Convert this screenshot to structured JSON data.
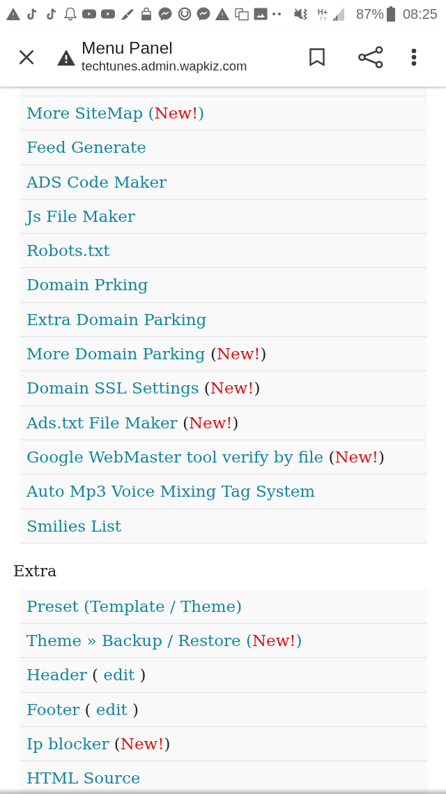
{
  "status_bar": {
    "network_type": "H+",
    "battery": "87%",
    "time": "08:25"
  },
  "toolbar": {
    "title": "Menu Panel",
    "url": "techtunes.admin.wapkiz.com"
  },
  "sections": [
    {
      "items": [
        {
          "parts": [
            {
              "kind": "link",
              "text": "More SiteMap ("
            },
            {
              "kind": "new",
              "text": "New!"
            },
            {
              "kind": "link",
              "text": ")"
            }
          ]
        },
        {
          "parts": [
            {
              "kind": "link",
              "text": "Feed Generate"
            }
          ]
        },
        {
          "parts": [
            {
              "kind": "link",
              "text": "ADS Code Maker"
            }
          ]
        },
        {
          "parts": [
            {
              "kind": "link",
              "text": "Js File Maker"
            }
          ]
        },
        {
          "parts": [
            {
              "kind": "link",
              "text": "Robots.txt"
            }
          ]
        },
        {
          "parts": [
            {
              "kind": "link",
              "text": "Domain Prking"
            }
          ]
        },
        {
          "parts": [
            {
              "kind": "link",
              "text": "Extra Domain Parking"
            }
          ]
        },
        {
          "parts": [
            {
              "kind": "link",
              "text": "More Domain Parking"
            },
            {
              "kind": "plain",
              "text": " ("
            },
            {
              "kind": "new",
              "text": "New!"
            },
            {
              "kind": "plain",
              "text": ")"
            }
          ]
        },
        {
          "parts": [
            {
              "kind": "link",
              "text": "Domain SSL Settings"
            },
            {
              "kind": "plain",
              "text": " ("
            },
            {
              "kind": "new",
              "text": "New!"
            },
            {
              "kind": "plain",
              "text": ")"
            }
          ]
        },
        {
          "parts": [
            {
              "kind": "link",
              "text": "Ads.txt File Maker"
            },
            {
              "kind": "plain",
              "text": " ("
            },
            {
              "kind": "new",
              "text": "New!"
            },
            {
              "kind": "plain",
              "text": ")"
            }
          ]
        },
        {
          "parts": [
            {
              "kind": "link",
              "text": "Google WebMaster tool verify by file"
            },
            {
              "kind": "plain",
              "text": " ("
            },
            {
              "kind": "new",
              "text": "New!"
            },
            {
              "kind": "plain",
              "text": ")"
            }
          ]
        },
        {
          "parts": [
            {
              "kind": "link",
              "text": "Auto Mp3 Voice Mixing Tag System"
            }
          ]
        },
        {
          "parts": [
            {
              "kind": "link",
              "text": "Smilies List"
            }
          ]
        }
      ]
    },
    {
      "heading": "Extra",
      "items": [
        {
          "parts": [
            {
              "kind": "link",
              "text": "Preset (Template / Theme)"
            }
          ]
        },
        {
          "parts": [
            {
              "kind": "link",
              "text": "Theme » Backup / Restore ("
            },
            {
              "kind": "new",
              "text": "New!"
            },
            {
              "kind": "link",
              "text": ")"
            }
          ]
        },
        {
          "parts": [
            {
              "kind": "link",
              "text": "Header"
            },
            {
              "kind": "plain",
              "text": " ( "
            },
            {
              "kind": "link",
              "text": "edit"
            },
            {
              "kind": "plain",
              "text": " )"
            }
          ]
        },
        {
          "parts": [
            {
              "kind": "link",
              "text": "Footer"
            },
            {
              "kind": "plain",
              "text": " ( "
            },
            {
              "kind": "link",
              "text": "edit"
            },
            {
              "kind": "plain",
              "text": " )"
            }
          ]
        },
        {
          "parts": [
            {
              "kind": "link",
              "text": "Ip blocker"
            },
            {
              "kind": "plain",
              "text": " ("
            },
            {
              "kind": "new",
              "text": "New!"
            },
            {
              "kind": "plain",
              "text": ")"
            }
          ]
        },
        {
          "parts": [
            {
              "kind": "link",
              "text": "HTML Source"
            }
          ]
        }
      ]
    }
  ]
}
